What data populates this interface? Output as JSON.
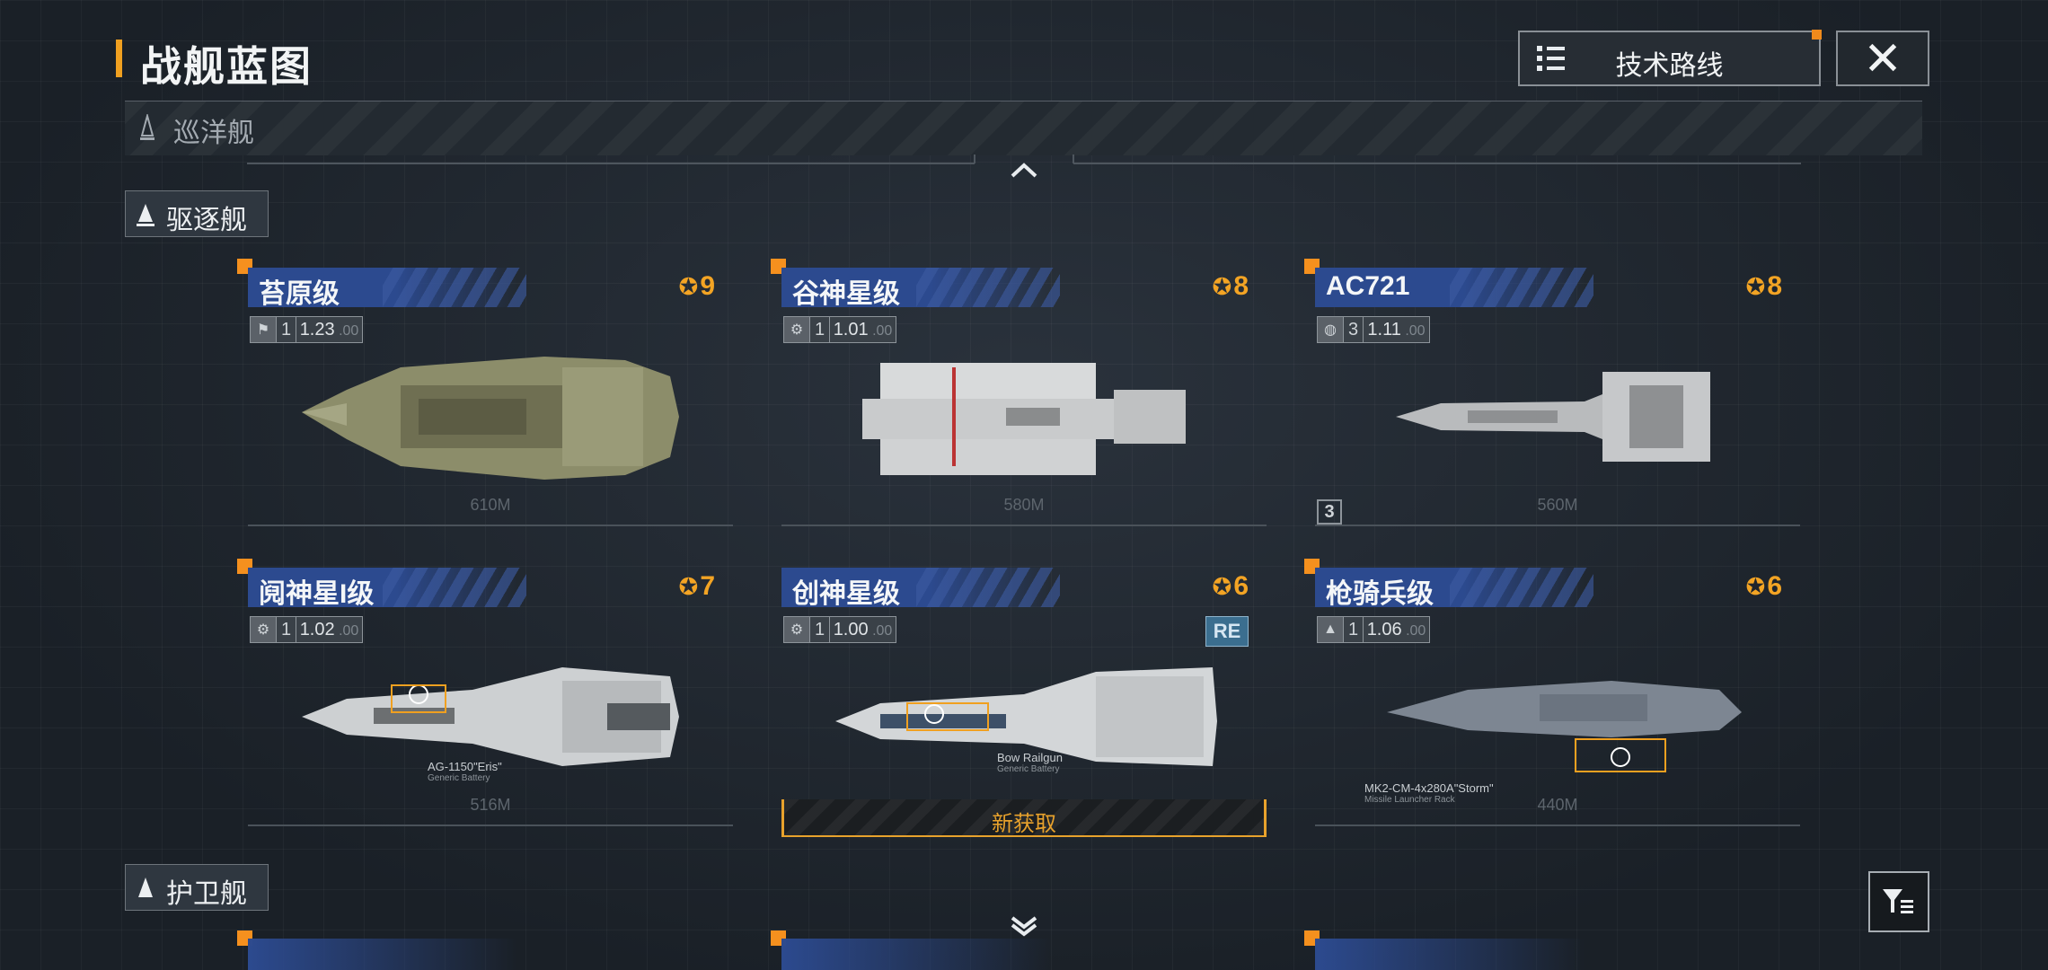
{
  "header": {
    "title": "战舰蓝图",
    "tech_route_label": "技术路线",
    "close_icon": "close-icon"
  },
  "cruiser_section": {
    "label": "巡洋舰"
  },
  "destroyer_section": {
    "label": "驱逐舰"
  },
  "frigate_section": {
    "label": "护卫舰"
  },
  "cards": [
    {
      "name": "苔原级",
      "rank": "9",
      "level": "1",
      "power": "1.23",
      "power_suffix": "00",
      "length": "610M",
      "stat_icon": "flag-icon",
      "hull_color": "#8c8d6a"
    },
    {
      "name": "谷神星级",
      "rank": "8",
      "level": "1",
      "power": "1.01",
      "power_suffix": "00",
      "length": "580M",
      "stat_icon": "cog-icon",
      "hull_color": "#c9cbcc"
    },
    {
      "name": "AC721",
      "rank": "8",
      "level": "3",
      "power": "1.11",
      "power_suffix": "00",
      "length": "560M",
      "stat_icon": "globe-icon",
      "hull_color": "#b9bbbd",
      "corner_tag": "3"
    },
    {
      "name": "阋神星I级",
      "rank": "7",
      "level": "1",
      "power": "1.02",
      "power_suffix": "00",
      "length": "516M",
      "stat_icon": "cog-icon",
      "hull_color": "#cdd0d2",
      "weapon": "AG-1150\"Eris\"",
      "weapon_sub": "Generic Battery"
    },
    {
      "name": "创神星级",
      "rank": "6",
      "level": "1",
      "power": "1.00",
      "power_suffix": "00",
      "length": "",
      "stat_icon": "cog-icon",
      "hull_color": "#d3d6d8",
      "badge": "RE",
      "weapon": "Bow Railgun",
      "weapon_sub": "Generic Battery",
      "new_label": "新获取"
    },
    {
      "name": "枪骑兵级",
      "rank": "6",
      "level": "1",
      "power": "1.06",
      "power_suffix": "00",
      "length": "440M",
      "stat_icon": "ship-icon",
      "hull_color": "#7d8692",
      "weapon": "MK2-CM-4x280A\"Storm\"",
      "weapon_sub": "Missile Launcher Rack"
    }
  ]
}
